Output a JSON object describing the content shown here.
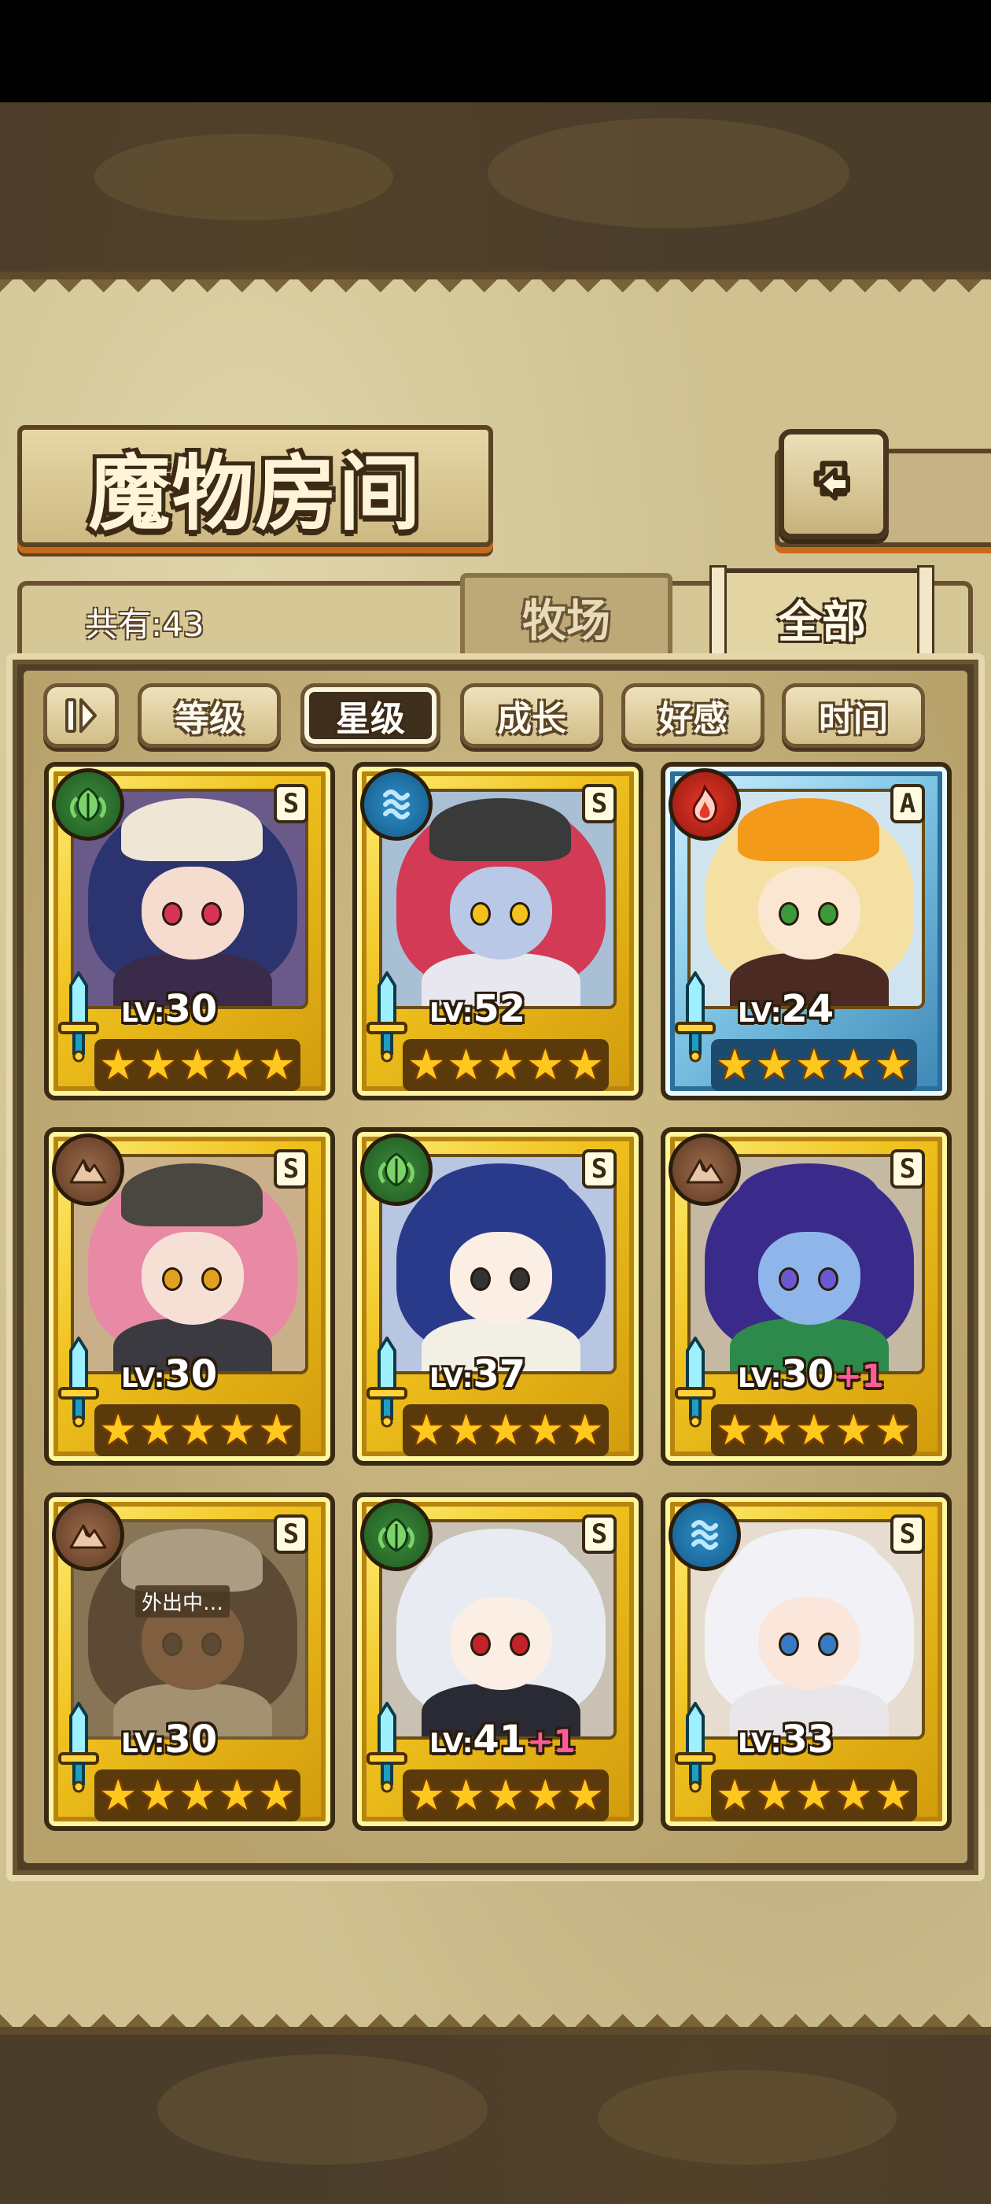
{
  "header": {
    "title": "魔物房间",
    "back_icon": "return-arrow-icon"
  },
  "tabs": {
    "total_label": "共有:43",
    "pasture": "牧场",
    "all": "全部",
    "active": "all"
  },
  "sort": {
    "toggle_icon": "sort-order-toggle-icon",
    "buttons": [
      "等级",
      "星级",
      "成长",
      "好感",
      "时间"
    ],
    "active": "星级"
  },
  "monsters": [
    {
      "element": "leaf",
      "rank": "S",
      "level_prefix": "LV:",
      "level": "30",
      "bonus": "",
      "stars": 5,
      "frame": "gold",
      "away": false,
      "colors": {
        "hair": "#2c3470",
        "skin": "#f6dccf",
        "body": "#3b2b4a",
        "eye": "#d9325a",
        "hat": "#efe6d6",
        "bg": "#6a5a8a"
      }
    },
    {
      "element": "water",
      "rank": "S",
      "level_prefix": "LV:",
      "level": "52",
      "bonus": "",
      "stars": 5,
      "frame": "gold",
      "away": false,
      "colors": {
        "hair": "#d23a55",
        "skin": "#b8c8e6",
        "body": "#e8e6ee",
        "eye": "#f3c21c",
        "hat": "#3a3a3a",
        "bg": "#a9bfd4"
      }
    },
    {
      "element": "fire",
      "rank": "A",
      "level_prefix": "LV:",
      "level": "24",
      "bonus": "",
      "stars": 5,
      "frame": "blue",
      "away": false,
      "colors": {
        "hair": "#f4e0a2",
        "skin": "#fbe6d2",
        "body": "#4a2a22",
        "eye": "#3c9a3a",
        "hat": "#f39a1a",
        "bg": "#d0e4ef"
      }
    },
    {
      "element": "earth",
      "rank": "S",
      "level_prefix": "LV:",
      "level": "30",
      "bonus": "",
      "stars": 5,
      "frame": "gold",
      "away": false,
      "colors": {
        "hair": "#e88aa6",
        "skin": "#f6e0d6",
        "body": "#3a3a40",
        "eye": "#e3a020",
        "hat": "#4a4640",
        "bg": "#c9b08a"
      }
    },
    {
      "element": "leaf",
      "rank": "S",
      "level_prefix": "LV:",
      "level": "37",
      "bonus": "",
      "stars": 5,
      "frame": "gold",
      "away": false,
      "colors": {
        "hair": "#2a3a8a",
        "skin": "#fbeee4",
        "body": "#f2efe4",
        "eye": "#333333",
        "hat": "#2a3a8a",
        "bg": "#b9c6e2"
      }
    },
    {
      "element": "earth",
      "rank": "S",
      "level_prefix": "LV:",
      "level": "30",
      "bonus": "+1",
      "stars": 5,
      "frame": "gold",
      "away": false,
      "colors": {
        "hair": "#3a2a8a",
        "skin": "#8fb6ea",
        "body": "#2e8a4a",
        "eye": "#6a5ad2",
        "hat": "#3a2a8a",
        "bg": "#c5b9a4"
      }
    },
    {
      "element": "earth",
      "rank": "S",
      "level_prefix": "LV:",
      "level": "30",
      "bonus": "",
      "stars": 5,
      "frame": "gold",
      "away": true,
      "away_label": "外出中…",
      "colors": {
        "hair": "#3a2a20",
        "skin": "#8a5a3a",
        "body": "#d8cba8",
        "eye": "#3a2a20",
        "hat": "#e8e0cc",
        "bg": "#9a8a6a"
      }
    },
    {
      "element": "leaf",
      "rank": "S",
      "level_prefix": "LV:",
      "level": "41",
      "bonus": "+1",
      "stars": 5,
      "frame": "gold",
      "away": false,
      "colors": {
        "hair": "#e8ecf2",
        "skin": "#fbeee4",
        "body": "#2a2a34",
        "eye": "#c4222a",
        "hat": "#e8ecf2",
        "bg": "#c9c2b4"
      }
    },
    {
      "element": "water",
      "rank": "S",
      "level_prefix": "LV:",
      "level": "33",
      "bonus": "",
      "stars": 5,
      "frame": "gold",
      "away": false,
      "colors": {
        "hair": "#f2f2f6",
        "skin": "#fbe6dc",
        "body": "#e9e6ea",
        "eye": "#3a7ac4",
        "hat": "#f2f2f6",
        "bg": "#e6dcd0"
      }
    }
  ],
  "element_icons": {
    "leaf": "leaf-icon",
    "water": "water-wave-icon",
    "fire": "fire-icon",
    "earth": "mountain-icon"
  }
}
